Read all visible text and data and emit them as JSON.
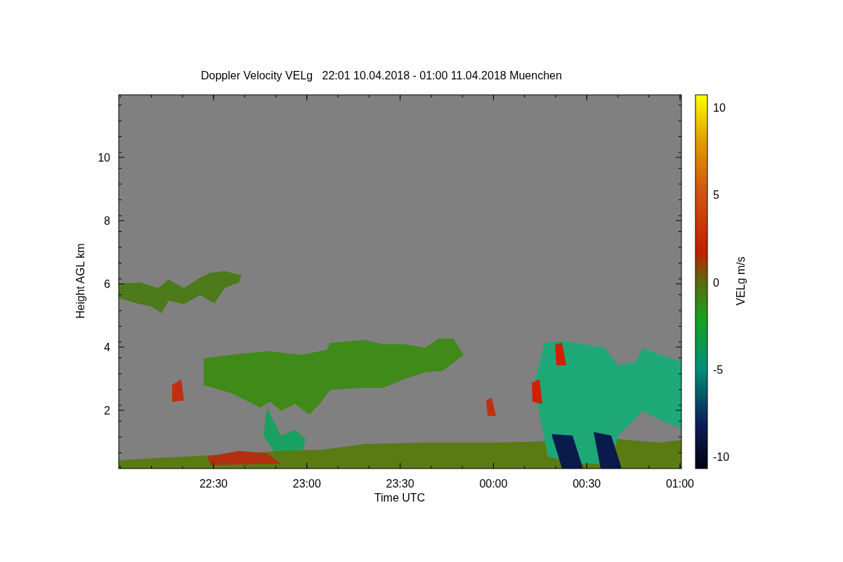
{
  "title": "Doppler Velocity VELg   22:01 10.04.2018 - 01:00 11.04.2018 Muenchen",
  "plot": {
    "ylabel": "Height AGL km",
    "xlabel": "Time UTC",
    "yticks": [
      "10",
      "8",
      "6",
      "4",
      "2"
    ],
    "xticks": [
      "22:30",
      "23:00",
      "23:30",
      "00:00",
      "00:30",
      "01:00"
    ]
  },
  "colorbar": {
    "label": "VELg m/s",
    "ticks": [
      "10",
      "5",
      "0",
      "-5",
      "-10"
    ]
  }
}
